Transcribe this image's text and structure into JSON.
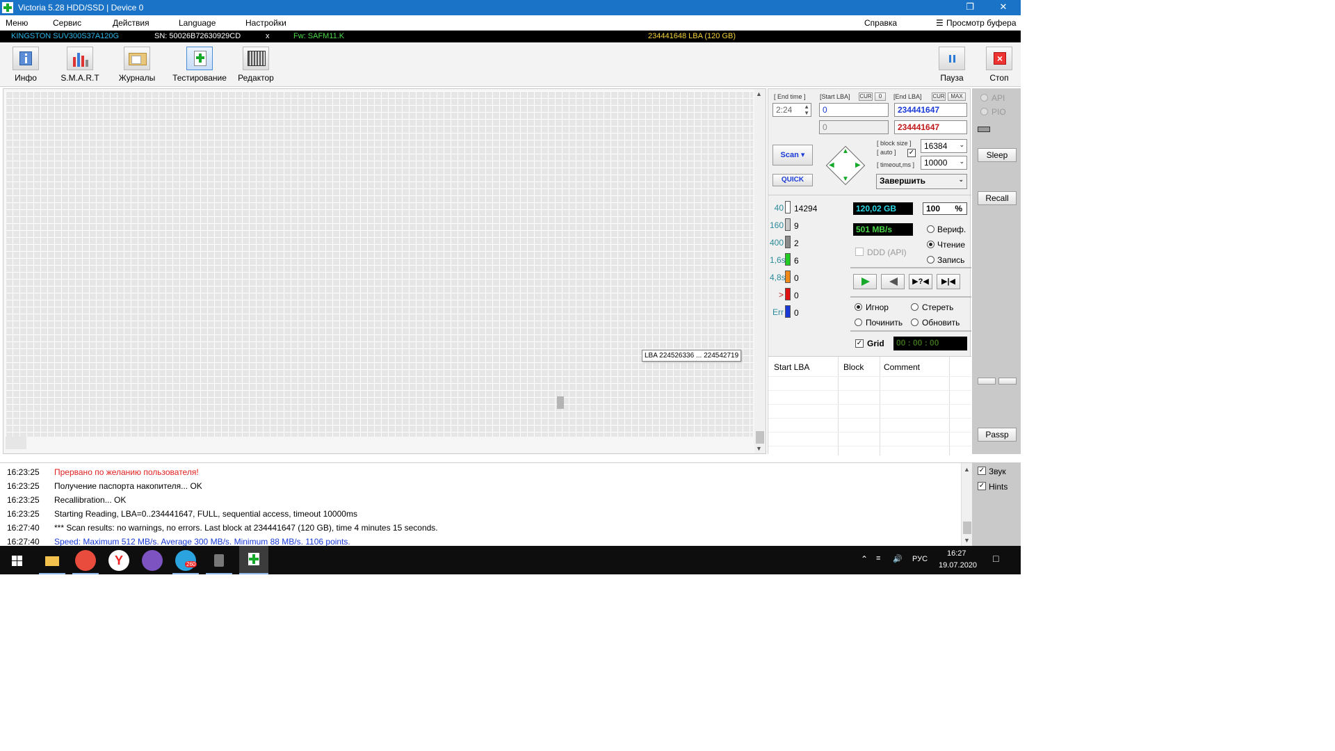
{
  "window": {
    "title": "Victoria 5.28 HDD/SSD | Device 0",
    "restore_glyph": "❐",
    "close_glyph": "✕"
  },
  "menu": {
    "items": [
      "Меню",
      "Сервис",
      "Действия",
      "Language",
      "Настройки"
    ],
    "help": "Справка",
    "buffer": "Просмотр буфера"
  },
  "device": {
    "model": "KINGSTON SUV300S37A120G",
    "serial": "SN: 50026B72630929CD",
    "close": "x",
    "firmware": "Fw: SAFM11.K",
    "capacity": "234441648 LBA (120 GB)"
  },
  "toolbar": {
    "info": "Инфо",
    "smart": "S.M.A.R.T",
    "logs": "Журналы",
    "testing": "Тестирование",
    "editor": "Редактор",
    "pause": "Пауза",
    "stop": "Стоп"
  },
  "map": {
    "tooltip": "LBA  224526336 ... 224542719",
    "scroll_up": "▲",
    "scroll_down": "▼"
  },
  "controls": {
    "end_time_label": "[ End time ]",
    "start_lba_label": "[Start LBA]",
    "cur_label": "CUR",
    "zero_label": "0",
    "end_lba_label": "[End LBA]",
    "max_label": "MAX",
    "end_time": "2:24",
    "start_lba": "0",
    "end_lba": "234441647",
    "start_lba_cur": "0",
    "end_lba_cur": "234441647",
    "scan_label": "Scan",
    "quick_label": "QUICK",
    "block_size_label": "[ block size ]",
    "auto_label": "[ auto ]",
    "timeout_label": "[ timeout,ms ]",
    "block_size": "16384",
    "timeout": "10000",
    "finish_action": "Завершить"
  },
  "legend": [
    {
      "label": "40",
      "count": "14294",
      "color": "#ffffff"
    },
    {
      "label": "160",
      "count": "9",
      "color": "#c8c8c8"
    },
    {
      "label": "400",
      "count": "2",
      "color": "#8a8a8a"
    },
    {
      "label": "1,6s",
      "count": "6",
      "color": "#22cc22"
    },
    {
      "label": "4,8s",
      "count": "0",
      "color": "#f08a1a"
    },
    {
      "label": ">",
      "count": "0",
      "color": "#e01010"
    },
    {
      "label": "Err",
      "count": "0",
      "color": "#1a3ad8"
    }
  ],
  "status": {
    "size": "120,02 GB",
    "percent": "100",
    "percent_sign": "%",
    "speed": "501 MB/s",
    "ddd": "DDD (API)",
    "verify": "Вериф.",
    "read": "Чтение",
    "write": "Запись",
    "ignore": "Игнор",
    "erase": "Стереть",
    "repair": "Починить",
    "refresh": "Обновить",
    "grid": "Grid",
    "timer": "00 : 00 : 00"
  },
  "results": {
    "col_start": "Start LBA",
    "col_block": "Block",
    "col_comment": "Comment"
  },
  "side": {
    "api": "API",
    "pio": "PIO",
    "sleep": "Sleep",
    "recall": "Recall",
    "passp": "Passp",
    "sound": "Звук",
    "hints": "Hints"
  },
  "log": [
    {
      "time": "16:23:25",
      "text": "Прервано по желанию пользователя!",
      "color": "#e02020"
    },
    {
      "time": "16:23:25",
      "text": "Получение паспорта накопителя... OK",
      "color": "#000000"
    },
    {
      "time": "16:23:25",
      "text": "Recallibration... OK",
      "color": "#000000"
    },
    {
      "time": "16:23:25",
      "text": "Starting Reading, LBA=0..234441647, FULL, sequential access, timeout 10000ms",
      "color": "#000000"
    },
    {
      "time": "16:27:40",
      "text": "*** Scan results: no warnings, no errors. Last block at 234441647 (120 GB), time 4 minutes 15 seconds.",
      "color": "#000000"
    },
    {
      "time": "16:27:40",
      "text": "Speed: Maximum 512 MB/s. Average 300 MB/s. Minimum 88 MB/s. 1106 points.",
      "color": "#1a3ad8"
    }
  ],
  "taskbar": {
    "lang": "РУС",
    "time": "16:27",
    "date": "19.07.2020",
    "badge": "260"
  }
}
